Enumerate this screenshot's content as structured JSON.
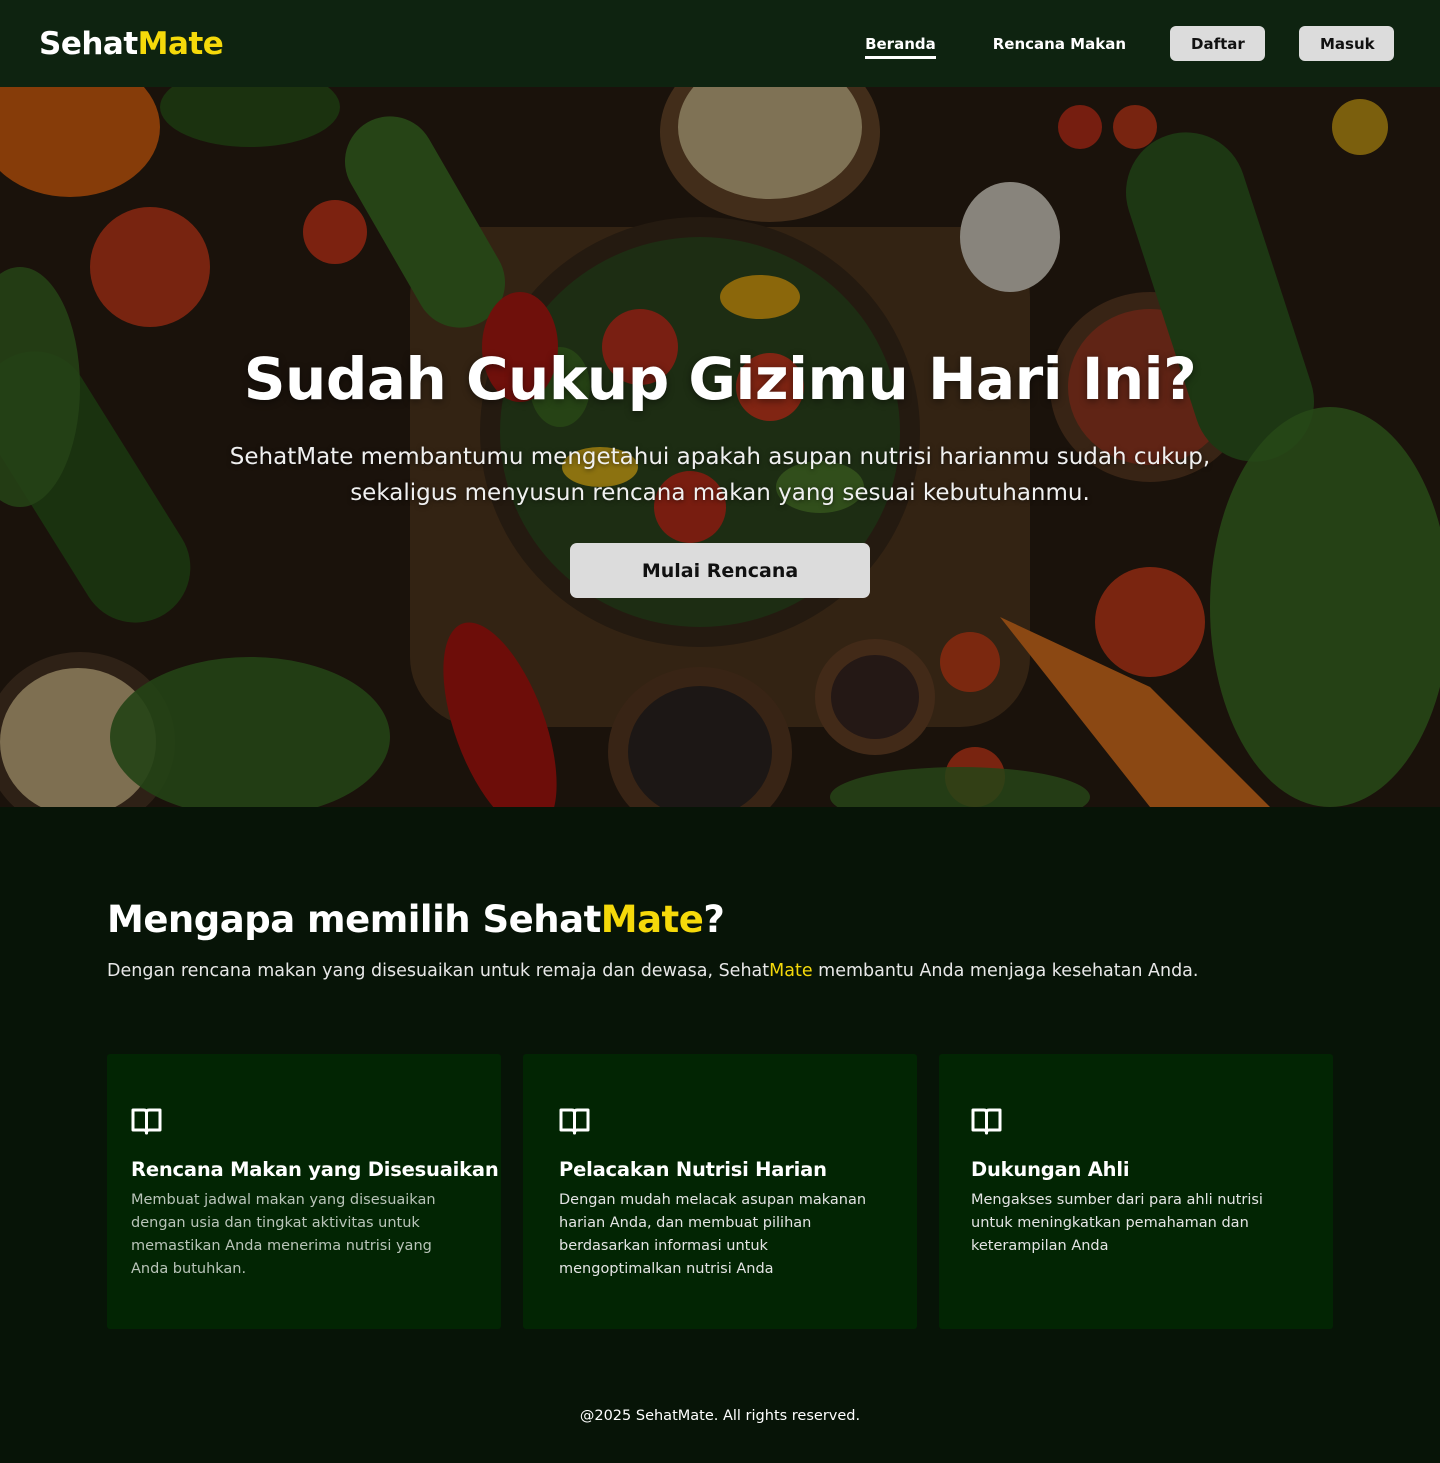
{
  "brand": {
    "name_part1": "Sehat",
    "name_part2": "Mate",
    "accent_color": "#f5d90a"
  },
  "nav": {
    "links": [
      "Beranda",
      "Rencana Makan"
    ],
    "active": "Beranda",
    "register_label": "Daftar",
    "login_label": "Masuk"
  },
  "hero": {
    "title": "Sudah Cukup Gizimu Hari Ini?",
    "subtitle": "SehatMate membantumu mengetahui apakah asupan nutrisi harianmu sudah cukup, sekaligus menyusun rencana makan yang sesuai kebutuhanmu.",
    "cta_label": "Mulai Rencana"
  },
  "features": {
    "title_prefix": "Mengapa memilih Sehat",
    "title_accent": "Mate",
    "title_suffix": "?",
    "desc_prefix": "Dengan rencana makan yang disesuaikan untuk remaja dan dewasa, Sehat",
    "desc_accent": "Mate",
    "desc_suffix": " membantu Anda menjaga kesehatan Anda.",
    "cards": [
      {
        "icon": "book-icon",
        "title": "Rencana Makan yang Disesuaikan",
        "text": "Membuat jadwal makan yang disesuaikan dengan usia dan tingkat aktivitas untuk memastikan Anda menerima nutrisi yang Anda butuhkan."
      },
      {
        "icon": "book-icon",
        "title": "Pelacakan Nutrisi Harian",
        "text": "Dengan mudah melacak asupan makanan harian Anda, dan membuat pilihan berdasarkan informasi untuk mengoptimalkan nutrisi Anda"
      },
      {
        "icon": "book-icon",
        "title": "Dukungan Ahli",
        "text": "Mengakses sumber dari para ahli nutrisi untuk meningkatkan pemahaman dan keterampilan Anda"
      }
    ]
  },
  "footer": {
    "copyright": "@2025 SehatMate. All rights reserved."
  },
  "colors": {
    "navbar": "#0e2310",
    "page": "#071407",
    "card": "#022503",
    "button": "#dcdcdc"
  }
}
